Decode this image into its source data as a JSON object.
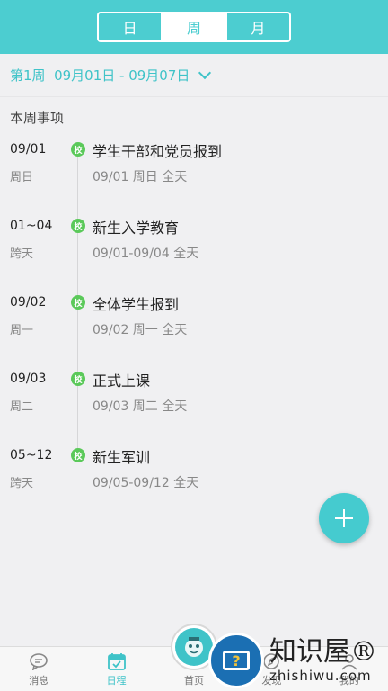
{
  "segment": {
    "tabs": [
      "日",
      "周",
      "月"
    ],
    "active_index": 1
  },
  "datebar": {
    "text": "第1周  09月01日 - 09月07日"
  },
  "section_title": "本周事项",
  "events": [
    {
      "date": "09/01",
      "sub": "周日",
      "badge": "校",
      "title": "学生干部和党员报到",
      "detail": "09/01 周日 全天"
    },
    {
      "date": "01~04",
      "sub": "跨天",
      "badge": "校",
      "title": "新生入学教育",
      "detail": "09/01-09/04 全天"
    },
    {
      "date": "09/02",
      "sub": "周一",
      "badge": "校",
      "title": "全体学生报到",
      "detail": "09/02 周一 全天"
    },
    {
      "date": "09/03",
      "sub": "周二",
      "badge": "校",
      "title": "正式上课",
      "detail": "09/03 周二 全天"
    },
    {
      "date": "05~12",
      "sub": "跨天",
      "badge": "校",
      "title": "新生军训",
      "detail": "09/05-09/12 全天"
    }
  ],
  "nav": {
    "items": [
      {
        "label": "消息",
        "icon": "message-icon"
      },
      {
        "label": "日程",
        "icon": "calendar-icon"
      },
      {
        "label": "首页",
        "icon": "home-mascot-icon"
      },
      {
        "label": "发现",
        "icon": "discover-icon"
      },
      {
        "label": "我的",
        "icon": "profile-icon"
      }
    ],
    "active_index": 1
  },
  "watermark": {
    "cn": "知识屋®",
    "en": "zhishiwu.com",
    "glyph": "?"
  },
  "colors": {
    "accent": "#4ccdd0",
    "badge": "#5bc95a"
  }
}
